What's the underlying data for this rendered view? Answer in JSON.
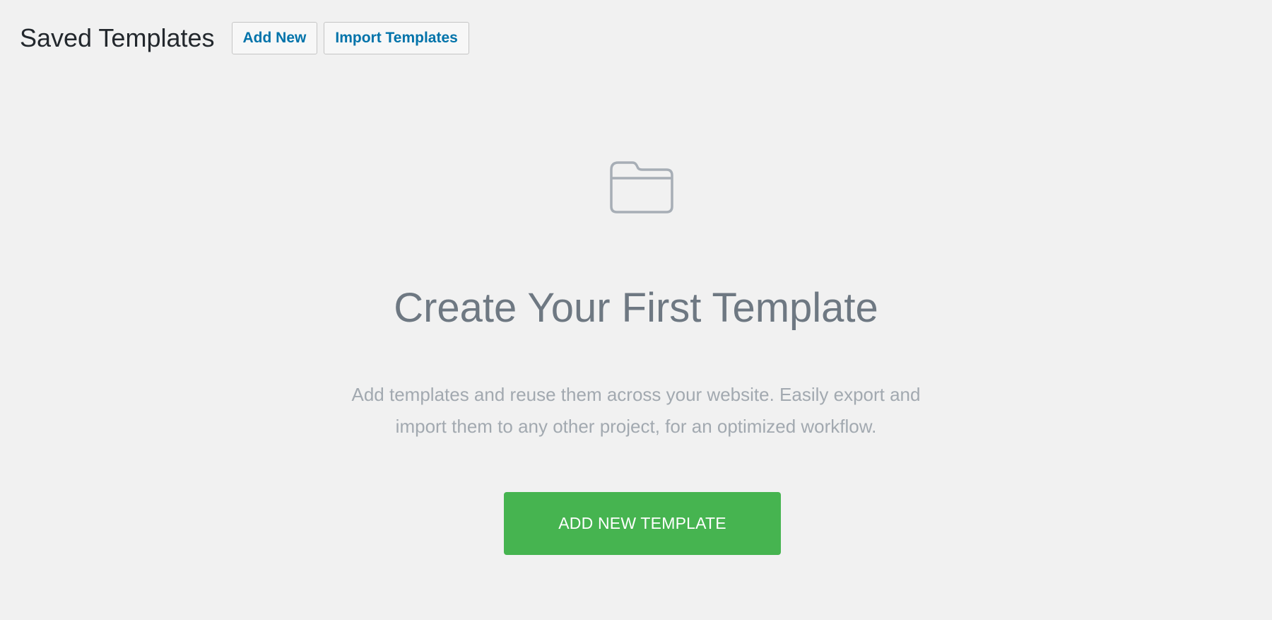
{
  "header": {
    "title": "Saved Templates",
    "add_new_label": "Add New",
    "import_label": "Import Templates"
  },
  "empty_state": {
    "icon": "folder-icon",
    "title": "Create Your First Template",
    "description_line1": "Add templates and reuse them across your website. Easily export and",
    "description_line2": "import them to any other project, for an optimized workflow.",
    "cta_label": "ADD NEW TEMPLATE"
  },
  "colors": {
    "background": "#f1f1f1",
    "link_blue": "#0073aa",
    "cta_green": "#46b450",
    "title_gray": "#6e7882",
    "desc_gray": "#a2a9b0",
    "icon_gray": "#a7aeb6"
  }
}
